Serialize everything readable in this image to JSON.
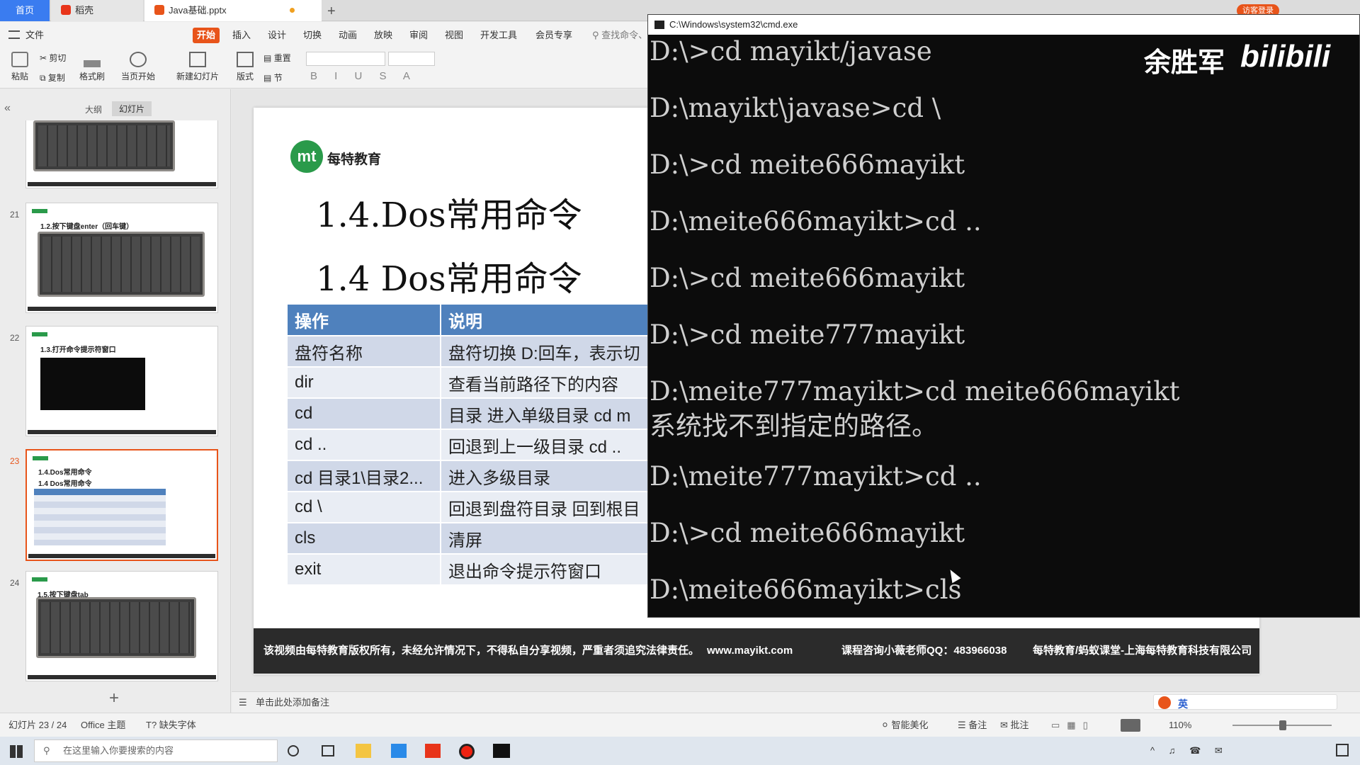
{
  "tabs": {
    "home": "首页",
    "wps": "稻壳",
    "doc": "Java基础.pptx",
    "login": "访客登录"
  },
  "menu": [
    "文件",
    "开始",
    "插入",
    "设计",
    "切换",
    "动画",
    "放映",
    "审阅",
    "视图",
    "开发工具",
    "会员专享"
  ],
  "search_placeholder": "查找命令、",
  "toolbar": {
    "paste": "粘贴",
    "cut": "剪切",
    "copy": "复制",
    "format_painter": "格式刷",
    "from_current": "当页开始",
    "new_slide": "新建幻灯片",
    "layout": "版式",
    "reset": "重置",
    "section": "节"
  },
  "panel_tabs": {
    "outline": "大纲",
    "slides": "幻灯片"
  },
  "thumbnails": [
    {
      "num": "21",
      "title": "1.2.按下键盘enter（回车键）"
    },
    {
      "num": "22",
      "title": "1.3.打开命令提示符窗口"
    },
    {
      "num": "23",
      "title": "1.4.Dos常用命令",
      "subtitle": "1.4 Dos常用命令"
    },
    {
      "num": "24",
      "title": "1.5.按下键盘tab"
    }
  ],
  "slide": {
    "logo_text": "每特教育",
    "title1": "1.4.Dos常用命令",
    "title2": "1.4 Dos常用命令",
    "table_header": [
      "操作",
      "说明"
    ],
    "rows": [
      [
        "盘符名称",
        "盘符切换 D:回车，表示切"
      ],
      [
        "dir",
        "查看当前路径下的内容"
      ],
      [
        "cd",
        "目录 进入单级目录 cd m"
      ],
      [
        "cd ..",
        "回退到上一级目录 cd .."
      ],
      [
        "cd 目录1\\目录2...",
        "进入多级目录"
      ],
      [
        "cd \\",
        "回退到盘符目录 回到根目"
      ],
      [
        "cls",
        "清屏"
      ],
      [
        "exit",
        "退出命令提示符窗口"
      ]
    ],
    "banner_left": "该视频由每特教育版权所有，未经允许情况下，不得私自分享视频，严重者须追究法律责任。",
    "banner_site": "www.mayikt.com",
    "banner_qq": "课程咨询小薇老师QQ：483966038",
    "banner_right": "每特教育/蚂蚁课堂-上海每特教育科技有限公司"
  },
  "cmd": {
    "title": "C:\\Windows\\system32\\cmd.exe",
    "lines": [
      "D:\\>cd mayikt/javase",
      "D:\\mayikt\\javase>cd \\",
      "D:\\>cd meite666mayikt",
      "D:\\meite666mayikt>cd ..",
      "D:\\>cd meite666mayikt",
      "D:\\>cd meite777mayikt",
      "D:\\meite777mayikt>cd meite666mayikt",
      "系统找不到指定的路径。",
      "D:\\meite777mayikt>cd ..",
      "D:\\>cd meite666mayikt",
      "D:\\meite666mayikt>cls"
    ]
  },
  "watermark": {
    "name": "余胜军",
    "brand": "bilibili"
  },
  "notes_placeholder": "单击此处添加备注",
  "status": {
    "slide_count": "幻灯片 23 / 24",
    "theme": "Office 主题",
    "missing_font": "缺失字体",
    "beautify": "智能美化",
    "notes": "备注",
    "comments": "批注",
    "zoom": "110%"
  },
  "taskbar": {
    "search_placeholder": "在这里输入你要搜索的内容"
  },
  "ime": {
    "lang": "英"
  }
}
